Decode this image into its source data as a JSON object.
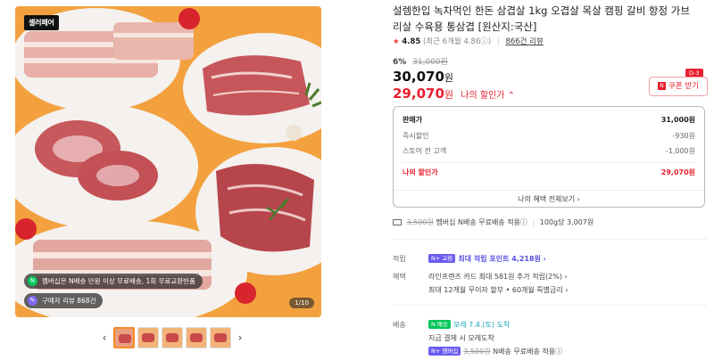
{
  "image": {
    "brand_badge": "셀러페어",
    "pill_membership": "멤버십은 N배송 만원 이상 무료배송, 1회 무료교환반품",
    "pill_reviews": "구매자 리뷰 868건",
    "pager": "1/10"
  },
  "thumbnails": {
    "prev_arrow": "‹",
    "next_arrow": "›"
  },
  "product": {
    "title": "설렘한입 녹차먹인 한돈 삼겹살 1kg 오겹살 목살 캠핑 갈비 항정 가브리살 수육용 통삼겹 [원산지:국산]",
    "rating_star": "★",
    "rating": "4.85",
    "rating_recent": "(최근 6개월 4.86ⓘ)",
    "review_count": "866건 리뷰",
    "discount_pct": "6%",
    "original_price": "31,000원",
    "price": "30,070",
    "price_unit": "원",
    "my_price": "29,070",
    "my_price_unit": "원",
    "my_price_label": "나의 할인가 ⌃"
  },
  "coupon": {
    "dday": "D-3",
    "icon": "N",
    "label": "쿠폰 받기"
  },
  "breakdown": {
    "rows": [
      {
        "label": "판매가",
        "value": "31,000원"
      },
      {
        "label": "즉시할인",
        "value": "-930원"
      },
      {
        "label": "스토어 전 고객",
        "value": "-1,000원"
      },
      {
        "label": "나의 할인가",
        "value": "29,070원"
      }
    ],
    "footer": "나의 혜택 전체보기 ›"
  },
  "shipping_summary": {
    "strike_fee": "3,500원",
    "text": "멤버십 N배송 무료배송 적용ⓘ",
    "sep": "|",
    "weight": "100g당 3,007원"
  },
  "points": {
    "label": "적립",
    "badge": "N+ 교환",
    "text": "최대 적립 포인트 4,218원 ›"
  },
  "benefits": {
    "label": "혜택",
    "line1": "라인프렌즈 카드 최대 581원 추가 적립(2%) ›",
    "line2": "최대 12개월 무이자 할부 • 60개월 특별금리 ›"
  },
  "delivery": {
    "label": "배송",
    "badge": "N 배송",
    "arrival": "모레 7.4.(토) 도착",
    "note": "지금 결제 시 모레도착",
    "member_badge": "N+ 멤버십",
    "strike_fee": "3,500원",
    "free_text": "N배송 무료배송 적용ⓘ"
  },
  "colors": {
    "accent_red": "#e8202f",
    "naver_green": "#03c75a",
    "membership_purple": "#6a5cf0",
    "image_bg": "#f19a3a"
  }
}
